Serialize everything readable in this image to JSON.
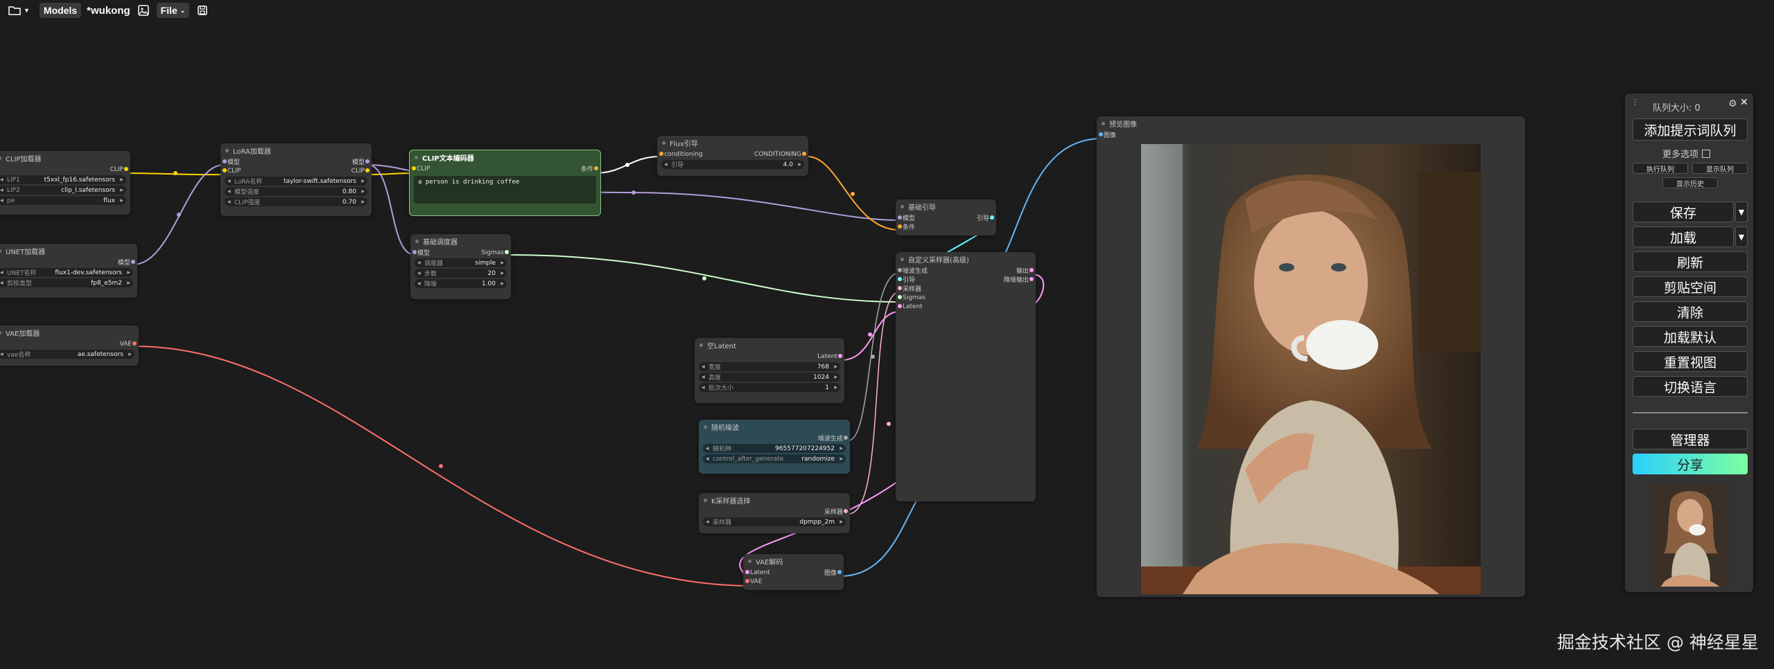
{
  "topbar": {
    "models_label": "Models",
    "workflow_name": "*wukong",
    "file_label": "File"
  },
  "nodes": {
    "clip_loader": {
      "title": "CLIP加载器",
      "output": "CLIP",
      "widgets": [
        {
          "label": "LIP1",
          "value": "t5xxl_fp16.safetensors"
        },
        {
          "label": "LIP2",
          "value": "clip_l.safetensors"
        },
        {
          "label": "pe",
          "value": "flux"
        }
      ]
    },
    "unet_loader": {
      "title": "UNET加载器",
      "output": "模型",
      "widgets": [
        {
          "label": "UNET名称",
          "value": "flux1-dev.safetensors"
        },
        {
          "label": "剪枝类型",
          "value": "fp8_e5m2"
        }
      ]
    },
    "vae_loader": {
      "title": "VAE加载器",
      "output": "VAE",
      "widgets": [
        {
          "label": "vae名称",
          "value": "ae.safetensors"
        }
      ]
    },
    "lora_loader": {
      "title": "LoRA加载器",
      "inputs": [
        "模型",
        "CLIP"
      ],
      "outputs": [
        "模型",
        "CLIP"
      ],
      "widgets": [
        {
          "label": "LoRA名称",
          "value": "taylor-swift.safetensors"
        },
        {
          "label": "模型强度",
          "value": "0.80"
        },
        {
          "label": "CLIP强度",
          "value": "0.70"
        }
      ]
    },
    "clip_text_encoder": {
      "title": "CLIP文本编码器",
      "input": "CLIP",
      "output": "条件",
      "text": "a person is drinking coffee"
    },
    "basic_scheduler": {
      "title": "基础调度器",
      "input": "模型",
      "output": "Sigmas",
      "widgets": [
        {
          "label": "调度器",
          "value": "simple"
        },
        {
          "label": "步数",
          "value": "20"
        },
        {
          "label": "降噪",
          "value": "1.00"
        }
      ]
    },
    "flux_guidance": {
      "title": "Flux引导",
      "input": "conditioning",
      "output": "CONDITIONING",
      "widgets": [
        {
          "label": "引导",
          "value": "4.0"
        }
      ]
    },
    "basic_guider": {
      "title": "基础引导",
      "inputs": [
        "模型",
        "条件"
      ],
      "output": "引导"
    },
    "custom_sampler": {
      "title": "自定义采样器(高级)",
      "inputs": [
        "噪波生成",
        "引导",
        "采样器",
        "Sigmas",
        "Latent"
      ],
      "outputs": [
        "输出",
        "降噪输出"
      ]
    },
    "empty_latent": {
      "title": "空Latent",
      "output": "Latent",
      "widgets": [
        {
          "label": "宽度",
          "value": "768"
        },
        {
          "label": "高度",
          "value": "1024"
        },
        {
          "label": "批次大小",
          "value": "1"
        }
      ]
    },
    "random_noise": {
      "title": "随机噪波",
      "output": "噪波生成",
      "widgets": [
        {
          "label": "随机种",
          "value": "965577207224952"
        },
        {
          "label": "control_after_generate",
          "value": "randomize"
        }
      ]
    },
    "ksampler_select": {
      "title": "K采样器选择",
      "output": "采样器",
      "widgets": [
        {
          "label": "采样器",
          "value": "dpmpp_2m"
        }
      ]
    },
    "vae_decode": {
      "title": "VAE解码",
      "inputs": [
        "Latent",
        "VAE"
      ],
      "output": "图像"
    },
    "preview_image": {
      "title": "预览图像",
      "input": "图像"
    }
  },
  "wire_colors": {
    "clip": "#ffd500",
    "model": "#b39ddb",
    "conditioning": "#ffa931",
    "vae": "#ff6e6e",
    "latent": "#ff9cf9",
    "image": "#64b5f6",
    "sigmas": "#cdffcd",
    "guider": "#66ffff"
  },
  "queue_panel": {
    "queue_size": "队列大小: 0",
    "queue_prompt": "添加提示词队列",
    "extra_options": "更多选项",
    "view_queue": "执行队列",
    "view_queue2": "显示队列",
    "view_history": "显示历史",
    "save": "保存",
    "load": "加载",
    "refresh": "刷新",
    "clipspace": "剪贴空间",
    "clear": "清除",
    "load_default": "加载默认",
    "reset_view": "重置视图",
    "switch_language": "切换语言",
    "manager": "管理器",
    "share": "分享"
  },
  "watermark": "掘金技术社区 @ 神经星星"
}
